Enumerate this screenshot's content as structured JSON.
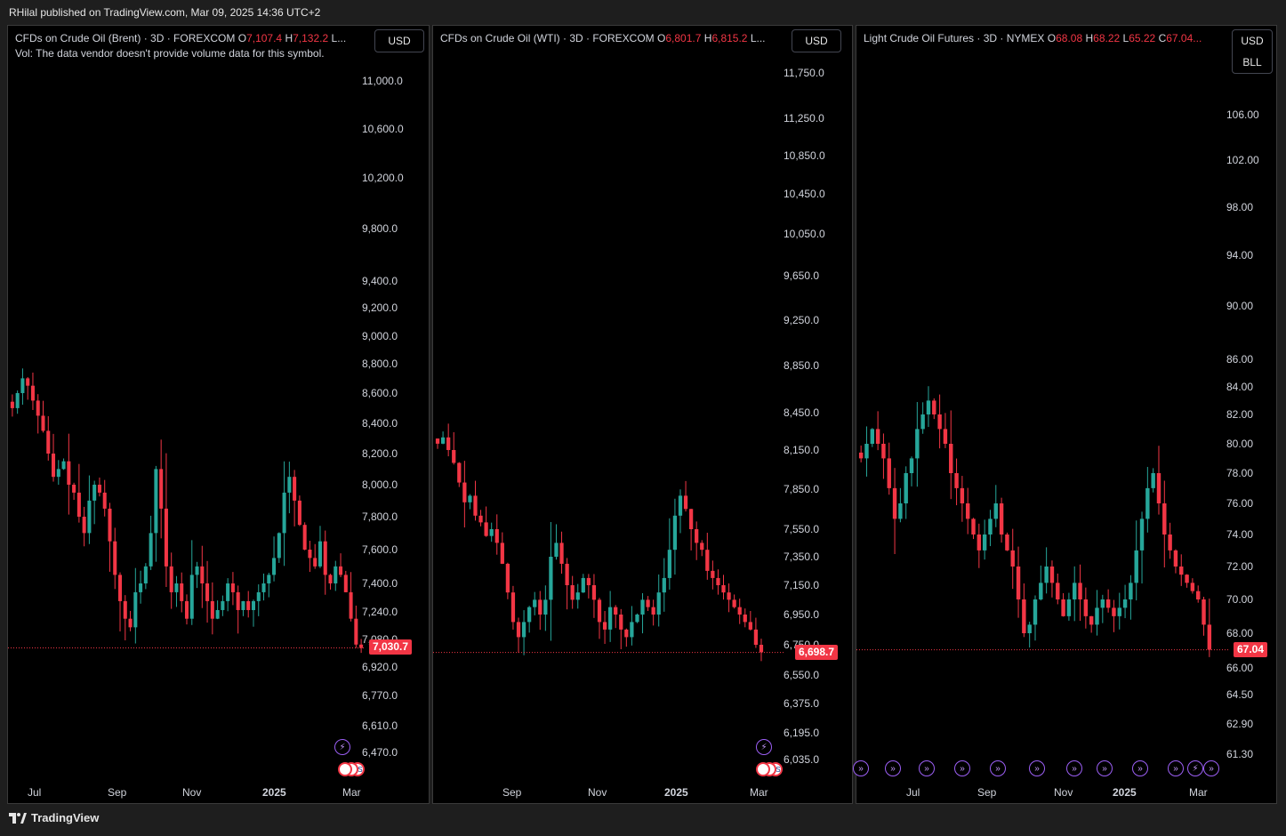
{
  "publish_line": "RHilal published on TradingView.com, Mar 09, 2025 14:36 UTC+2",
  "footer": {
    "brand": "TradingView"
  },
  "colors": {
    "up": "#26a69a",
    "down": "#f23645",
    "background": "#000000",
    "event": "#9c5ff5"
  },
  "panels": [
    {
      "title": "CFDs on Crude Oil (Brent) · 3D · FOREXCOM",
      "ohlc": {
        "o_label": "O",
        "o": "7,107.4",
        "h_label": "H",
        "h": "7,132.2",
        "l_label": "L..."
      },
      "volume_note": "Vol: The data vendor doesn't provide volume data for this symbol.",
      "currency": "USD",
      "unit": "",
      "last_price": "7,030.7",
      "x_ticks": [
        {
          "label": "Jul",
          "bold": false
        },
        {
          "label": "Sep",
          "bold": false
        },
        {
          "label": "Nov",
          "bold": false
        },
        {
          "label": "2025",
          "bold": true
        },
        {
          "label": "Mar",
          "bold": false
        }
      ],
      "events": {
        "lightning": "⚡",
        "flags": "US"
      }
    },
    {
      "title": "CFDs on Crude Oil (WTI) · 3D · FOREXCOM",
      "ohlc": {
        "o_label": "O",
        "o": "6,801.7",
        "h_label": "H",
        "h": "6,815.2",
        "l_label": "L..."
      },
      "volume_note": "",
      "currency": "USD",
      "unit": "",
      "last_price": "6,698.7",
      "x_ticks": [
        {
          "label": "Sep",
          "bold": false
        },
        {
          "label": "Nov",
          "bold": false
        },
        {
          "label": "2025",
          "bold": true
        },
        {
          "label": "Mar",
          "bold": false
        }
      ],
      "events": {
        "lightning": "⚡",
        "flags": "US"
      }
    },
    {
      "title": "Light Crude Oil Futures · 3D · NYMEX",
      "ohlc": {
        "o_label": "O",
        "o": "68.08",
        "h_label": "H",
        "h": "68.22",
        "l_label": "L",
        "l": "65.22",
        "c_label": "C",
        "c": "67.04..."
      },
      "volume_note": "",
      "currency": "USD",
      "unit": "BLL",
      "last_price": "67.04",
      "x_ticks": [
        {
          "label": "Jul",
          "bold": false
        },
        {
          "label": "Sep",
          "bold": false
        },
        {
          "label": "Nov",
          "bold": false
        },
        {
          "label": "2025",
          "bold": true
        },
        {
          "label": "Mar",
          "bold": false
        }
      ],
      "events": {
        "lightning": "⚡",
        "arrow": "»"
      }
    }
  ],
  "chart_data": [
    {
      "type": "candlestick",
      "title": "CFDs on Crude Oil (Brent) · 3D · FOREXCOM",
      "x": [
        "Jul",
        "Sep",
        "Nov",
        "2025",
        "Mar"
      ],
      "y_ticks": [
        "11,000.0",
        "10,600.0",
        "10,200.0",
        "9,800.0",
        "9,400.0",
        "9,200.0",
        "9,000.0",
        "8,800.0",
        "8,600.0",
        "8,400.0",
        "8,200.0",
        "8,000.0",
        "7,800.0",
        "7,600.0",
        "7,400.0",
        "7,240.0",
        "7,080.0",
        "6,920.0",
        "6,770.0",
        "6,610.0",
        "6,470.0"
      ],
      "y_values": [
        11000,
        10600,
        10200,
        9800,
        9400,
        9200,
        9000,
        8800,
        8600,
        8400,
        8200,
        8000,
        7800,
        7600,
        7400,
        7240,
        7080,
        6920,
        6770,
        6610,
        6470
      ],
      "log_scale": true,
      "ylim": [
        6400,
        11300
      ],
      "last": 7030.7,
      "closes": [
        8500,
        8600,
        8700,
        8650,
        8550,
        8450,
        8350,
        8200,
        8050,
        8100,
        8150,
        8000,
        7950,
        7800,
        7700,
        7900,
        8000,
        7950,
        7850,
        7650,
        7450,
        7300,
        7200,
        7150,
        7350,
        7400,
        7500,
        7700,
        8100,
        7850,
        7500,
        7350,
        7400,
        7300,
        7200,
        7450,
        7500,
        7400,
        7300,
        7200,
        7250,
        7300,
        7400,
        7350,
        7250,
        7300,
        7250,
        7300,
        7350,
        7400,
        7450,
        7550,
        7700,
        7950,
        8050,
        7900,
        7750,
        7600,
        7550,
        7500,
        7650,
        7450,
        7400,
        7500,
        7450,
        7350,
        7200,
        7050,
        7030
      ]
    },
    {
      "type": "candlestick",
      "title": "CFDs on Crude Oil (WTI) · 3D · FOREXCOM",
      "x": [
        "Sep",
        "Nov",
        "2025",
        "Mar"
      ],
      "y_ticks": [
        "11,750.0",
        "11,250.0",
        "10,850.0",
        "10,450.0",
        "10,050.0",
        "9,650.0",
        "9,250.0",
        "8,850.0",
        "8,450.0",
        "8,150.0",
        "7,850.0",
        "7,550.0",
        "7,350.0",
        "7,150.0",
        "6,950.0",
        "6,750.0",
        "6,550.0",
        "6,375.0",
        "6,195.0",
        "6,035.0"
      ],
      "y_values": [
        11750,
        11250,
        10850,
        10450,
        10050,
        9650,
        9250,
        8850,
        8450,
        8150,
        7850,
        7550,
        7350,
        7150,
        6950,
        6750,
        6550,
        6375,
        6195,
        6035
      ],
      "log_scale": true,
      "ylim": [
        5950,
        12050
      ],
      "last": 6698.7,
      "closes": [
        8200,
        8250,
        8150,
        8050,
        7900,
        7750,
        7800,
        7650,
        7600,
        7500,
        7550,
        7450,
        7300,
        7100,
        6900,
        6800,
        6900,
        7000,
        7050,
        6950,
        7050,
        7350,
        7450,
        7300,
        7150,
        7050,
        7100,
        7200,
        7150,
        7050,
        6900,
        6850,
        7000,
        6950,
        6850,
        6800,
        6900,
        6950,
        7050,
        7000,
        6950,
        7100,
        7200,
        7400,
        7650,
        7800,
        7700,
        7550,
        7450,
        7400,
        7250,
        7200,
        7150,
        7100,
        7050,
        7000,
        6950,
        6900,
        6850,
        6750,
        6700
      ]
    },
    {
      "type": "candlestick",
      "title": "Light Crude Oil Futures · 3D · NYMEX",
      "x": [
        "Jul",
        "Sep",
        "Nov",
        "2025",
        "Mar"
      ],
      "y_ticks": [
        "106.00",
        "102.00",
        "98.00",
        "94.00",
        "90.00",
        "86.00",
        "84.00",
        "82.00",
        "80.00",
        "78.00",
        "76.00",
        "74.00",
        "72.00",
        "70.00",
        "68.00",
        "66.00",
        "64.50",
        "62.90",
        "61.30"
      ],
      "y_values": [
        106,
        102,
        98,
        94,
        90,
        86,
        84,
        82,
        80,
        78,
        76,
        74,
        72,
        70,
        68,
        66,
        64.5,
        62.9,
        61.3
      ],
      "log_scale": true,
      "ylim": [
        60.5,
        109.5
      ],
      "last": 67.04,
      "closes": [
        79,
        80,
        81,
        80,
        79,
        77,
        75,
        76,
        78,
        79,
        81,
        82,
        83,
        82,
        81,
        80,
        78,
        77,
        76,
        75,
        74,
        73,
        74,
        75,
        76,
        74,
        73,
        72,
        70,
        68,
        68.5,
        70,
        71,
        72,
        71,
        70,
        69,
        70,
        71,
        70,
        69,
        68.5,
        69.5,
        70,
        69.5,
        69,
        69.5,
        70,
        71,
        73,
        75,
        77,
        78,
        76,
        74,
        73,
        72,
        71.5,
        71,
        70.5,
        70,
        68.5,
        67.04
      ]
    }
  ]
}
